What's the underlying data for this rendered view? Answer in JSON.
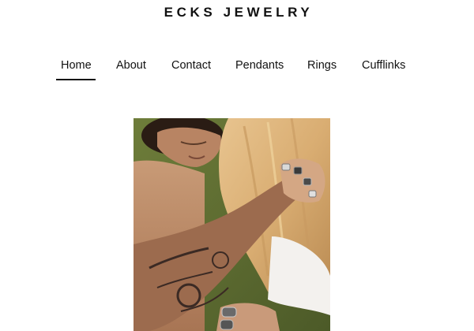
{
  "site": {
    "title": "ECKS JEWELRY"
  },
  "nav": {
    "items": [
      {
        "label": "Home",
        "active": true
      },
      {
        "label": "About",
        "active": false
      },
      {
        "label": "Contact",
        "active": false
      },
      {
        "label": "Pendants",
        "active": false
      },
      {
        "label": "Rings",
        "active": false
      },
      {
        "label": "Cufflinks",
        "active": false
      }
    ]
  },
  "colors": {
    "text": "#111111",
    "background": "#ffffff",
    "active_underline": "#111111"
  }
}
